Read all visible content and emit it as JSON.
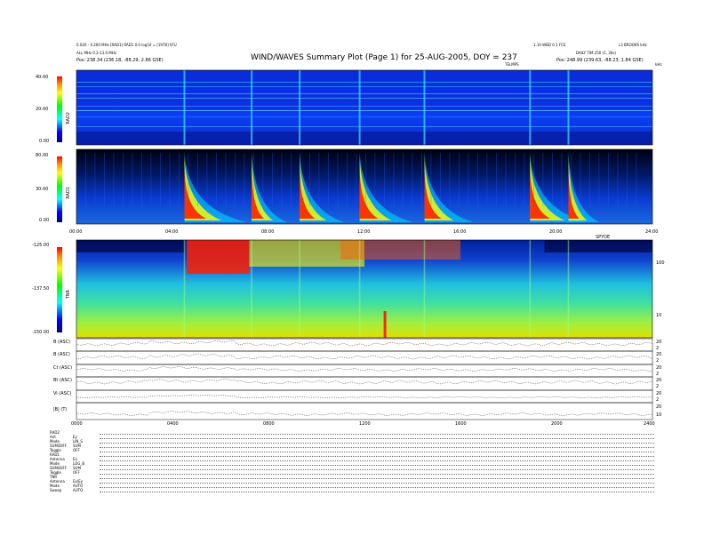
{
  "header": {
    "left_line1": "0.020 - 0.200 MHz [RAD1] RAD1 0.0 log10 = [1978] SFU",
    "left_line2": "ALL MHz 0.2-13.0 MHz",
    "left_line3": "Pos:   238.34 (236.18, -88.29, 2.86 GSE)",
    "title": "WIND/WAVES Summary Plot (Page 1) for 25-AUG-2005, DOY = 237",
    "right_line1a": "1.10 WBD 0.1 FCE",
    "right_line1b": "L3 BROOKS kHz",
    "right_line2": "DAILY TIM 250 (1, 30s)",
    "right_line3": "Pos:   248.99 (239.63, -88.23, 1.84 GSE)",
    "sub_center": "TELMPS",
    "sub_right": "kHz"
  },
  "panels": {
    "rad2": {
      "label": "RAD2",
      "ticks": [
        "40.00",
        "20.00",
        "0.00"
      ]
    },
    "rad1": {
      "label": "RAD1",
      "ticks": [
        "80.00",
        "30.00",
        "0.00"
      ]
    },
    "tnr": {
      "label": "TNR",
      "ticks": [
        "-125.00",
        "-137.50",
        "-150.00"
      ],
      "right_ticks": [
        "100",
        "10"
      ]
    },
    "time_axis_top": [
      "00:00",
      "04:00",
      "08:00",
      "12:00",
      "16:00",
      "20:00",
      "24:00"
    ],
    "time_axis_top_extra": "SPYDE",
    "time_axis_bottom": [
      "0000",
      "0400",
      "0800",
      "1200",
      "1600",
      "2000",
      "2400"
    ]
  },
  "lines": [
    {
      "label": "B (ASC)",
      "rticks": [
        "20",
        "2"
      ]
    },
    {
      "label": "B (ASC)",
      "rticks": [
        "20",
        "2"
      ]
    },
    {
      "label": "Ct (ASC)",
      "rticks": [
        "20",
        "2"
      ]
    },
    {
      "label": "Bt (ASC)",
      "rticks": [
        "20",
        "2"
      ]
    },
    {
      "label": "Vi (ASC)",
      "rticks": [
        "20",
        "2"
      ]
    },
    {
      "label": "|B| (T)",
      "rticks": [
        "20",
        "10"
      ]
    }
  ],
  "meta_rows": [
    [
      "RAD2",
      ""
    ],
    [
      "Ant",
      "Ey"
    ],
    [
      "Mode",
      "LIN_S"
    ],
    [
      "SUM/DIFF",
      "SUM"
    ],
    [
      "Toggle",
      "OFF"
    ],
    [
      "RAD1",
      ""
    ],
    [
      "Antenna",
      "Ex"
    ],
    [
      "Mode",
      "LOG_B"
    ],
    [
      "SUM/DIFF",
      "SUM"
    ],
    [
      "Toggle",
      "OFF"
    ],
    [
      "TNR",
      ""
    ],
    [
      "Antenna",
      "Ex/Ey"
    ],
    [
      "Mode",
      "AUTO"
    ],
    [
      "Sweep",
      "AUTO"
    ]
  ],
  "chart_data": {
    "type": "heatmap",
    "title": "WIND/WAVES Summary Plot (Page 1) for 25-AUG-2005, DOY = 237",
    "x": [
      "00:00",
      "04:00",
      "08:00",
      "12:00",
      "16:00",
      "20:00",
      "24:00"
    ],
    "series": [
      {
        "name": "RAD2",
        "ylim": [
          0,
          40
        ]
      },
      {
        "name": "RAD1",
        "ylim": [
          0,
          80
        ]
      },
      {
        "name": "TNR",
        "ylim": [
          -150,
          -125
        ]
      }
    ],
    "events_hours": [
      4.5,
      7.3,
      9.3,
      11.8,
      14.5,
      18.9,
      20.5
    ]
  }
}
